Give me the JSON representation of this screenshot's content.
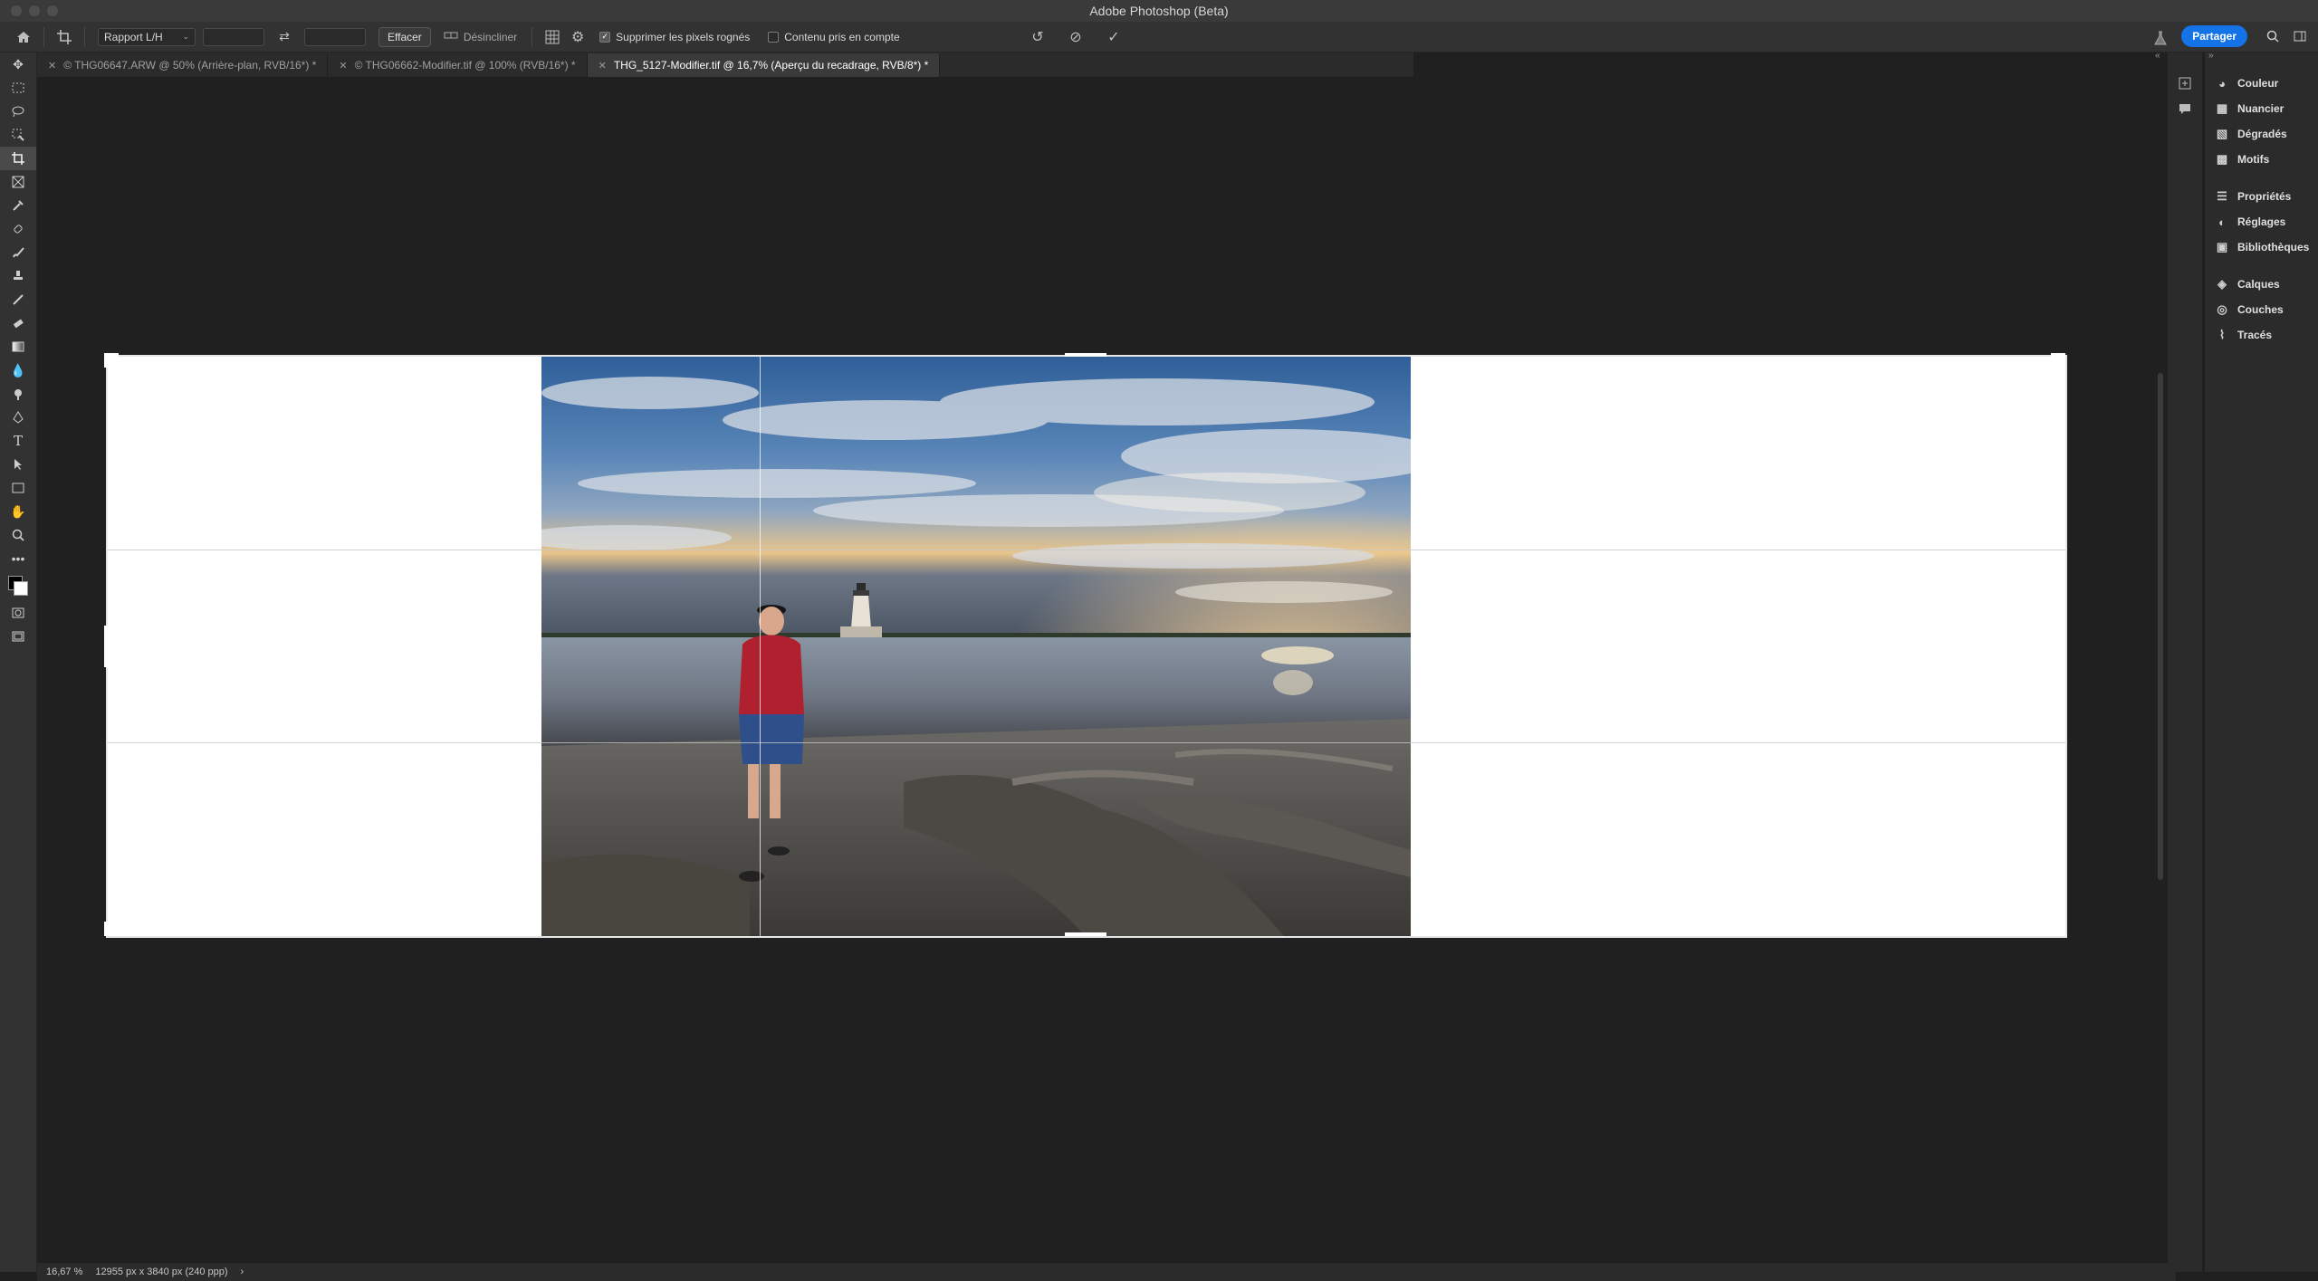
{
  "app": {
    "title": "Adobe Photoshop (Beta)"
  },
  "options": {
    "ratio_select": "Rapport L/H",
    "clear_button": "Effacer",
    "straighten_label": "Désincliner",
    "delete_cropped_label": "Supprimer les pixels rognés",
    "delete_cropped_checked": true,
    "content_aware_label": "Contenu pris en compte",
    "content_aware_checked": false,
    "share_button": "Partager"
  },
  "tabs": [
    {
      "label": "© THG06647.ARW @ 50% (Arrière-plan, RVB/16*) *",
      "active": false
    },
    {
      "label": "© THG06662-Modifier.tif @ 100% (RVB/16*) *",
      "active": false
    },
    {
      "label": "THG_5127-Modifier.tif @ 16,7% (Aperçu du recadrage, RVB/8*) *",
      "active": true
    }
  ],
  "panels": {
    "group1": [
      {
        "label": "Couleur",
        "icon": "color-wheel-icon"
      },
      {
        "label": "Nuancier",
        "icon": "swatches-icon"
      },
      {
        "label": "Dégradés",
        "icon": "gradient-icon"
      },
      {
        "label": "Motifs",
        "icon": "patterns-icon"
      }
    ],
    "group2": [
      {
        "label": "Propriétés",
        "icon": "properties-icon"
      },
      {
        "label": "Réglages",
        "icon": "adjustments-icon"
      },
      {
        "label": "Bibliothèques",
        "icon": "libraries-icon"
      }
    ],
    "group3": [
      {
        "label": "Calques",
        "icon": "layers-icon"
      },
      {
        "label": "Couches",
        "icon": "channels-icon"
      },
      {
        "label": "Tracés",
        "icon": "paths-icon"
      }
    ]
  },
  "status": {
    "zoom": "16,67 %",
    "doc_size": "12955 px x 3840 px (240 ppp)",
    "arrow": "›"
  },
  "colors": {
    "accent": "#1473e6",
    "canvas": "#202020",
    "panel": "#2b2b2b"
  }
}
